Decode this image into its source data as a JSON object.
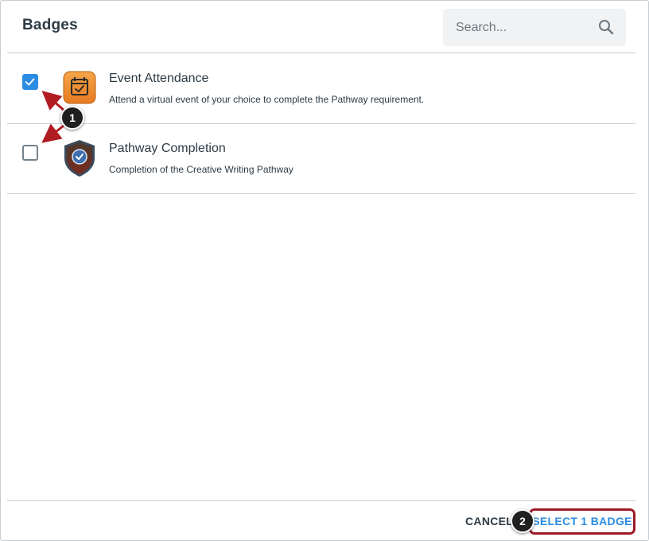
{
  "dialog": {
    "title": "Badges",
    "search": {
      "placeholder": "Search...",
      "value": ""
    }
  },
  "badges": [
    {
      "name": "Event Attendance",
      "description": "Attend a virtual event of your choice to complete the Pathway requirement.",
      "checked": true,
      "icon": "calendar-check-icon"
    },
    {
      "name": "Pathway Completion",
      "description": "Completion of the Creative Writing Pathway",
      "checked": false,
      "icon": "shield-badge-icon"
    }
  ],
  "footer": {
    "cancel_label": "CANCEL",
    "select_label": "SELECT 1 BADGE"
  },
  "callouts": [
    "1",
    "2"
  ],
  "colors": {
    "accent": "#2b8ce4",
    "callout_arrow": "#b01c22",
    "highlight_border": "#9b1b2a"
  }
}
